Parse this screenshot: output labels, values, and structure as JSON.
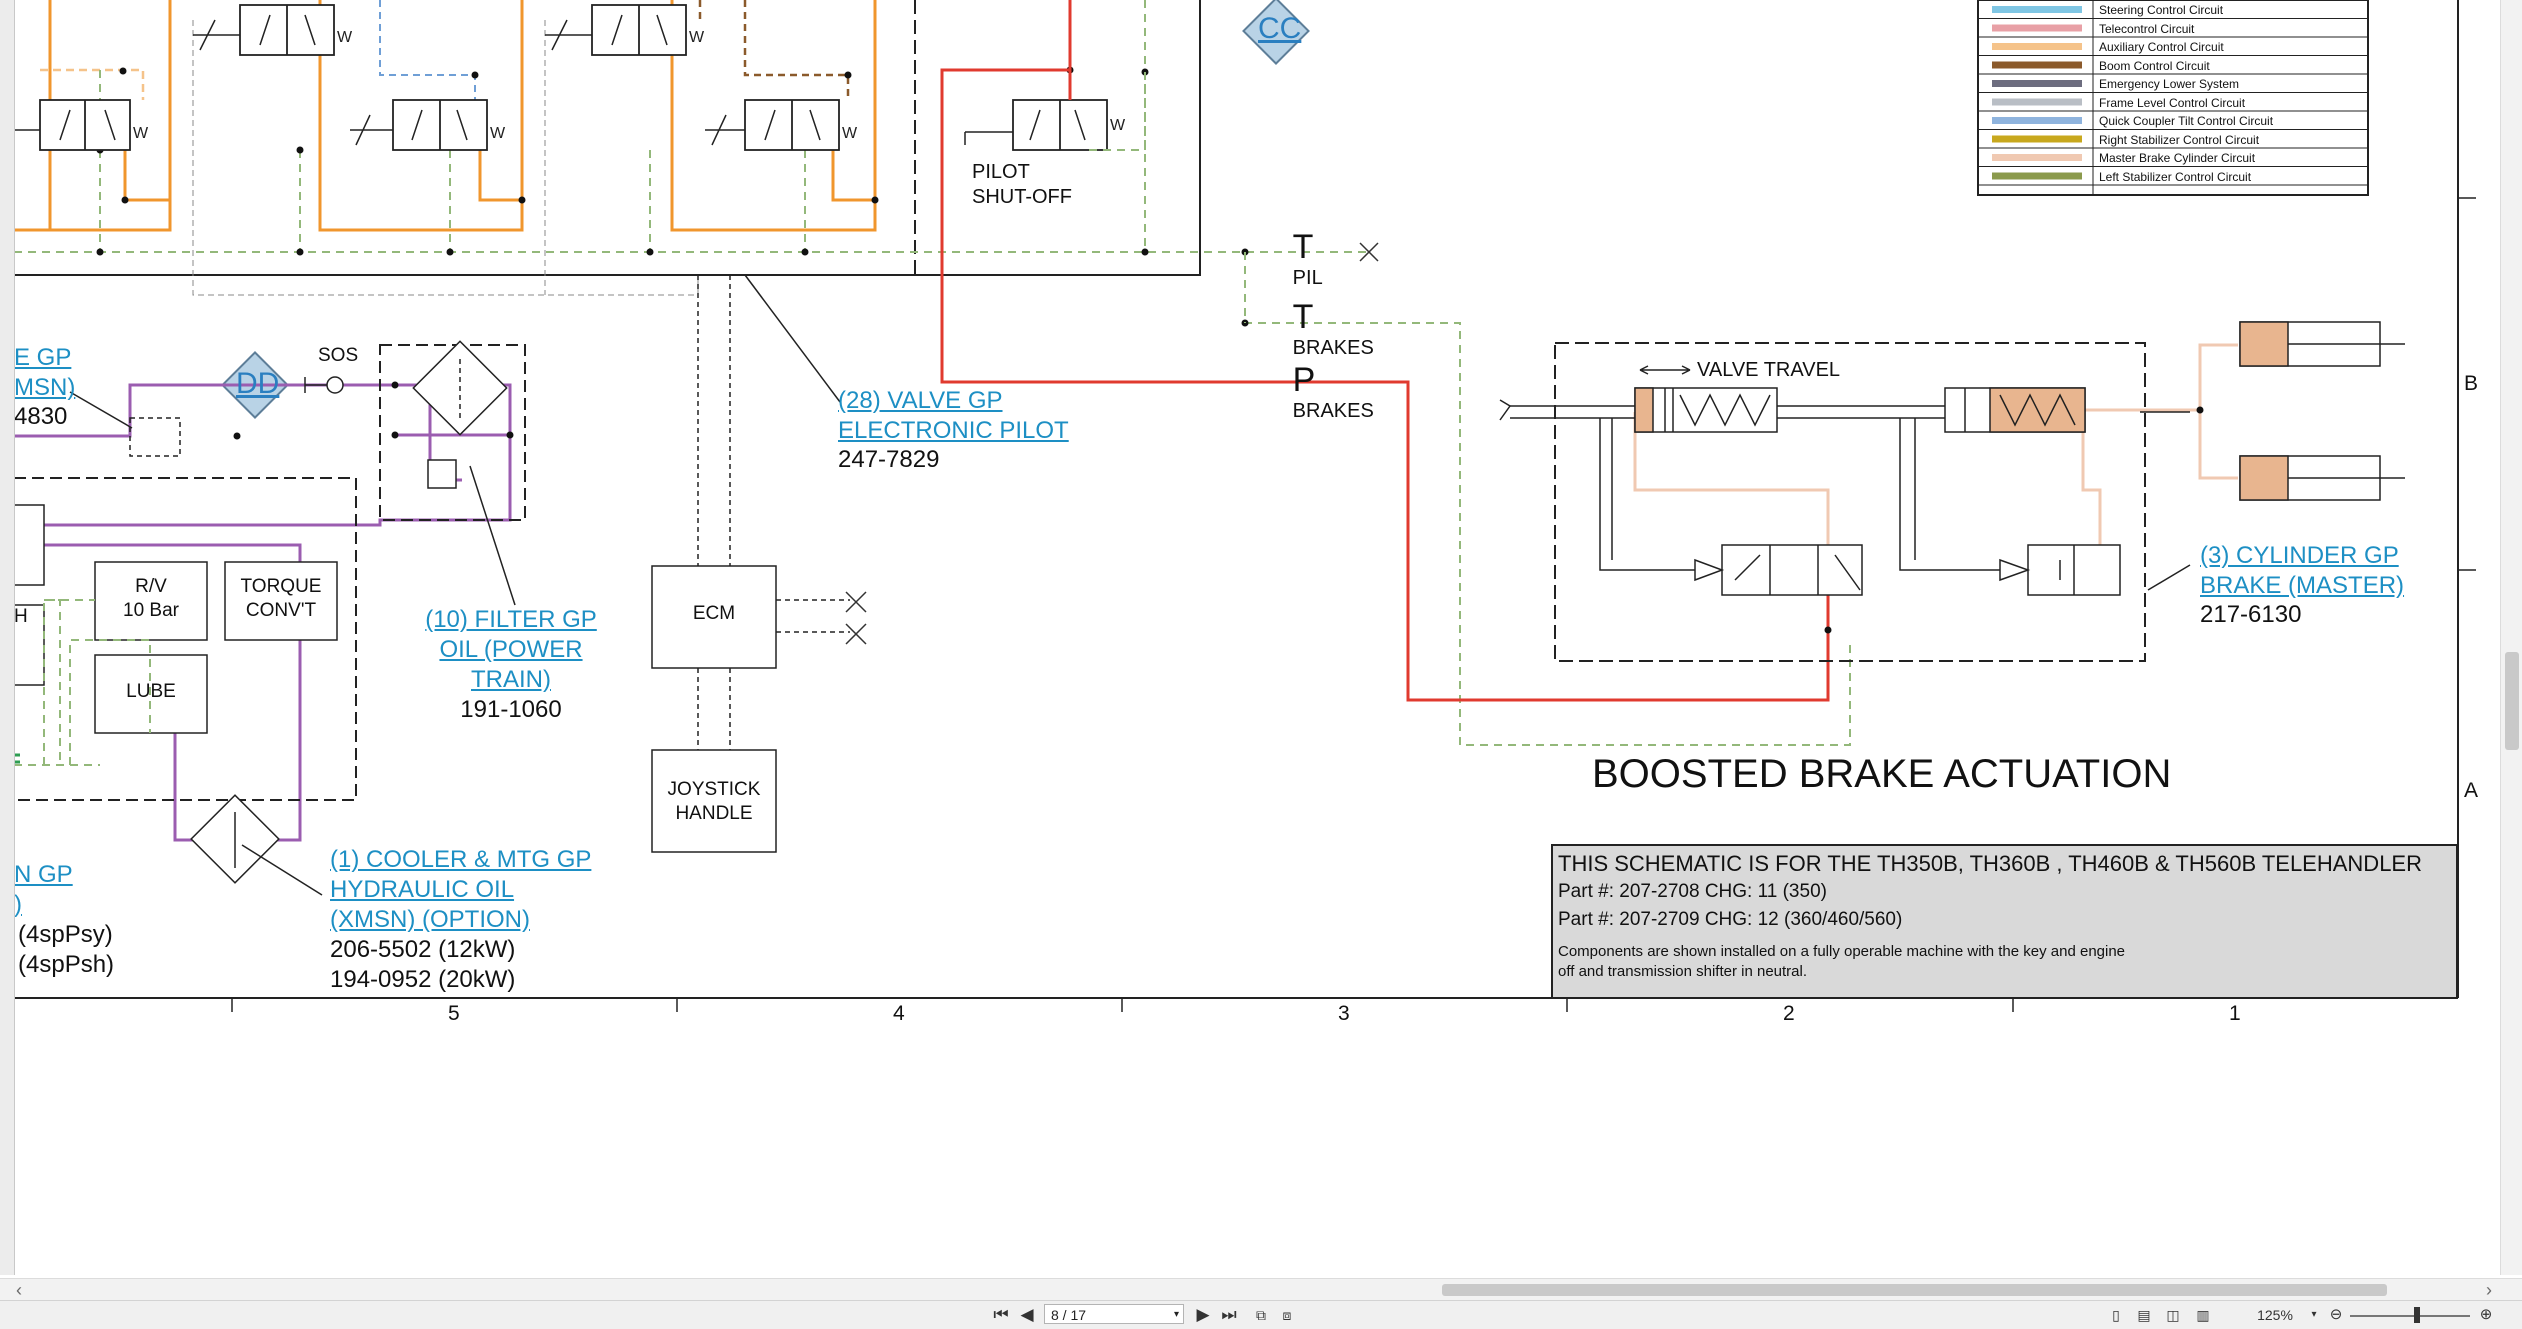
{
  "legend": {
    "items": [
      {
        "label": "Steering Control Circuit",
        "color": "#7fc6e4"
      },
      {
        "label": "Telecontrol Circuit",
        "color": "#e8a0a6"
      },
      {
        "label": "Auxiliary Control Circuit",
        "color": "#f5c38a"
      },
      {
        "label": "Boom Control Circuit",
        "color": "#8b5a2b"
      },
      {
        "label": "Emergency Lower System",
        "color": "#6d6d7f"
      },
      {
        "label": "Frame Level Control Circuit",
        "color": "#b9bec5"
      },
      {
        "label": "Quick Coupler Tilt Control Circuit",
        "color": "#8fb4de"
      },
      {
        "label": "Right Stabilizer Control Circuit",
        "color": "#c8a81e"
      },
      {
        "label": "Master Brake Cylinder Circuit",
        "color": "#f0c9b2"
      },
      {
        "label": "Left Stabilizer Control Circuit",
        "color": "#8b9a4c"
      }
    ]
  },
  "markers": {
    "cc": "CC",
    "dd": "DD"
  },
  "schematic": {
    "pilot_shutoff": "PILOT\nSHUT-OFF",
    "t_pil": {
      "main": "T",
      "sub": "PIL"
    },
    "t_brakes": {
      "main": "T",
      "sub": "BRAKES"
    },
    "p_brakes": {
      "main": "P",
      "sub": "BRAKES"
    },
    "valve_travel": "VALVE TRAVEL",
    "sos": "SOS",
    "rv": "R/V\n10 Bar",
    "torque_conv": "TORQUE\nCONV'T",
    "lube": "LUBE",
    "h_partial": "H",
    "ecm": "ECM",
    "joystick": "JOYSTICK\nHANDLE",
    "boosted_title": "BOOSTED BRAKE ACTUATION"
  },
  "callouts": {
    "valve_gp_link": "(28) VALVE GP\nELECTRONIC PILOT",
    "valve_gp_part": "247-7829",
    "filter_gp_link": "(10) FILTER GP\nOIL (POWER\nTRAIN)",
    "filter_gp_part": "191-1060",
    "cooler_link": "(1) COOLER & MTG GP\nHYDRAULIC OIL\n(XMSN) (OPTION)",
    "cooler_parts": "206-5502 (12kW)\n194-0952 (20kW)",
    "cylinder_link": "(3) CYLINDER GP\nBRAKE (MASTER)",
    "cylinder_part": "217-6130",
    "left_cut_1_link": "E GP\nMSN)",
    "left_cut_1_text": "4830",
    "left_cut_2_link": "N GP\n)",
    "left_cut_2_text": "(4spPsy)\n(4spPsh)"
  },
  "title_block": {
    "line1": "THIS SCHEMATIC IS FOR THE TH350B, TH360B , TH460B & TH560B TELEHANDLER",
    "line2": "Part #: 207-2708 CHG: 11 (350)",
    "line3": "Part #: 207-2709 CHG: 12 (360/460/560)",
    "note": "Components are shown installed on a fully operable machine with the key and engine\noff and transmission shifter in neutral."
  },
  "grid": {
    "columns": [
      "5",
      "4",
      "3",
      "2",
      "1"
    ],
    "rows": [
      "B",
      "A"
    ]
  },
  "toolbar": {
    "first": "⏮",
    "prev": "◀",
    "page_value": "8 / 17",
    "next": "▶",
    "last": "⏭",
    "zoom": "125%"
  }
}
